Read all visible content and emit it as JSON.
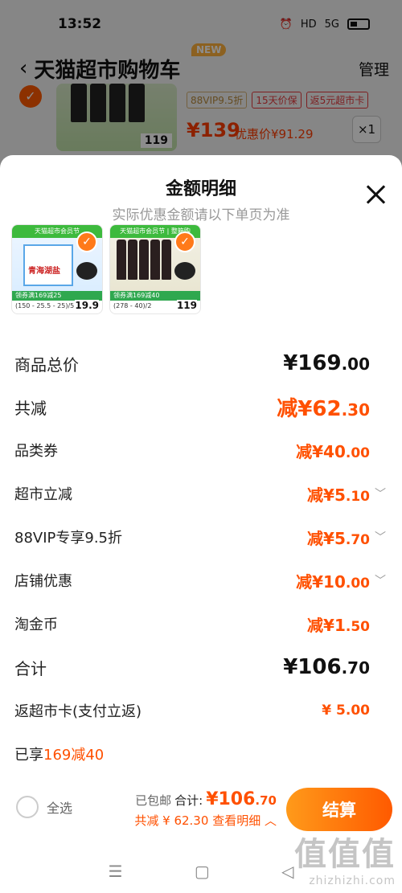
{
  "status_bar": {
    "time": "13:52",
    "icons": [
      "alarm-icon",
      "hd-icon",
      "5g-signal-icon",
      "battery-icon"
    ],
    "hd_label": "HD",
    "network_label": "5G"
  },
  "cart": {
    "back_icon": "chevron-left-icon",
    "title": "天猫超市购物车",
    "new_badge": "NEW",
    "manage": "管理",
    "item": {
      "tags": [
        "88VIP9.5折",
        "15天价保",
        "返5元超市卡"
      ],
      "price": "¥139",
      "deal_price": "优惠价¥91.29",
      "qty": "×1",
      "thumb_price": "119",
      "thumb_promo": "领券满169减40",
      "thumb_specs": "(278 - 40)/2"
    }
  },
  "sheet": {
    "title": "金额明细",
    "subtitle": "实际优惠金额请以下单页为准",
    "thumbs": [
      {
        "banner": "天猫超市会员节",
        "promo": "领券满169减25",
        "specs": "(150 - 25.5 - 25)/5",
        "price": "19.9",
        "pack_text": "青海湖盐"
      },
      {
        "banner": "天猫超市会员节 | 整箱购",
        "promo": "领券满169减40",
        "specs": "(278 - 40)/2",
        "price": "119"
      }
    ],
    "rows": [
      {
        "label": "商品总价",
        "value": "¥169",
        "dec": ".00"
      },
      {
        "label": "共减",
        "value": "减¥62",
        "dec": ".30"
      },
      {
        "label": "品类券",
        "value": "减¥40",
        "dec": ".00"
      },
      {
        "label": "超市立减",
        "value": "减¥5",
        "dec": ".10"
      },
      {
        "label": "88VIP专享9.5折",
        "value": "减¥5",
        "dec": ".70"
      },
      {
        "label": "店铺优惠",
        "value": "减¥10",
        "dec": ".00"
      },
      {
        "label": "淘金币",
        "value": "减¥1",
        "dec": ".50"
      },
      {
        "label": "合计",
        "value": "¥106",
        "dec": ".70"
      },
      {
        "label": "返超市卡(支付立返)",
        "value": "¥ 5.00",
        "dec": ""
      }
    ],
    "enjoy_prefix": "已享",
    "enjoy_value": "169减40"
  },
  "footer": {
    "select_all": "全选",
    "shipping": "已包邮",
    "total_label": "合计:",
    "total": "¥106",
    "total_dec": ".70",
    "detail": "共减 ¥ 62.30",
    "view_detail": "查看明细",
    "checkout": "结算"
  },
  "nav_bar": {
    "menu": "☰",
    "home": "▢",
    "back": "◁"
  },
  "watermark": {
    "big": "值值值",
    "small": "zhizhizhi.com"
  },
  "colors": {
    "accent": "#ff5000",
    "checkout_start": "#ff9a1a",
    "checkout_end": "#ff5a00",
    "promo_green": "#3dba3d"
  }
}
